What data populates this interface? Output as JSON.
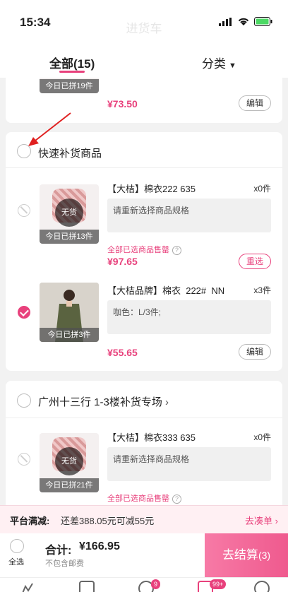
{
  "status": {
    "time": "15:34"
  },
  "nav": {
    "title": "进货车"
  },
  "tabs": {
    "all": "全部(15)",
    "category": "分类"
  },
  "group1": {
    "item": {
      "thumb_label": "今日已拼19件",
      "price": "¥73.50",
      "edit": "编辑"
    }
  },
  "group2": {
    "title": "快速补货商品",
    "items": [
      {
        "name": "【大桔】棉衣222 635",
        "qty": "x0件",
        "spec": "请重新选择商品规格",
        "nostock": "无货",
        "thumb_label": "今日已拼13件",
        "soldout": "全部已选商品售罄",
        "price": "¥97.65",
        "action": "重选"
      },
      {
        "name": "【大桔品牌】棉衣  222#  NN",
        "qty": "x3件",
        "spec": "咖色：L/3件;",
        "thumb_label": "今日已拼3件",
        "price": "¥55.65",
        "action": "编辑"
      }
    ]
  },
  "group3": {
    "title": "广州十三行 1-3楼补货专场",
    "items": [
      {
        "name": "【大桔】棉衣333 635",
        "qty": "x0件",
        "spec": "请重新选择商品规格",
        "nostock": "无货",
        "thumb_label": "今日已拼21件",
        "soldout": "全部已选商品售罄"
      }
    ]
  },
  "promo": {
    "label": "平台满减:",
    "text": "还差388.05元可减55元",
    "link": "去凑单"
  },
  "footer": {
    "select_all": "全选",
    "total_label": "合计:",
    "total_value": "¥166.95",
    "shipping_note": "不包含邮费",
    "checkout": "去结算",
    "checkout_count": "(3)"
  },
  "tabbar": {
    "badge_msgs": "9",
    "badge_cart": "99+"
  },
  "colors": {
    "accent": "#e8417c",
    "background": "#f2f2f2"
  }
}
